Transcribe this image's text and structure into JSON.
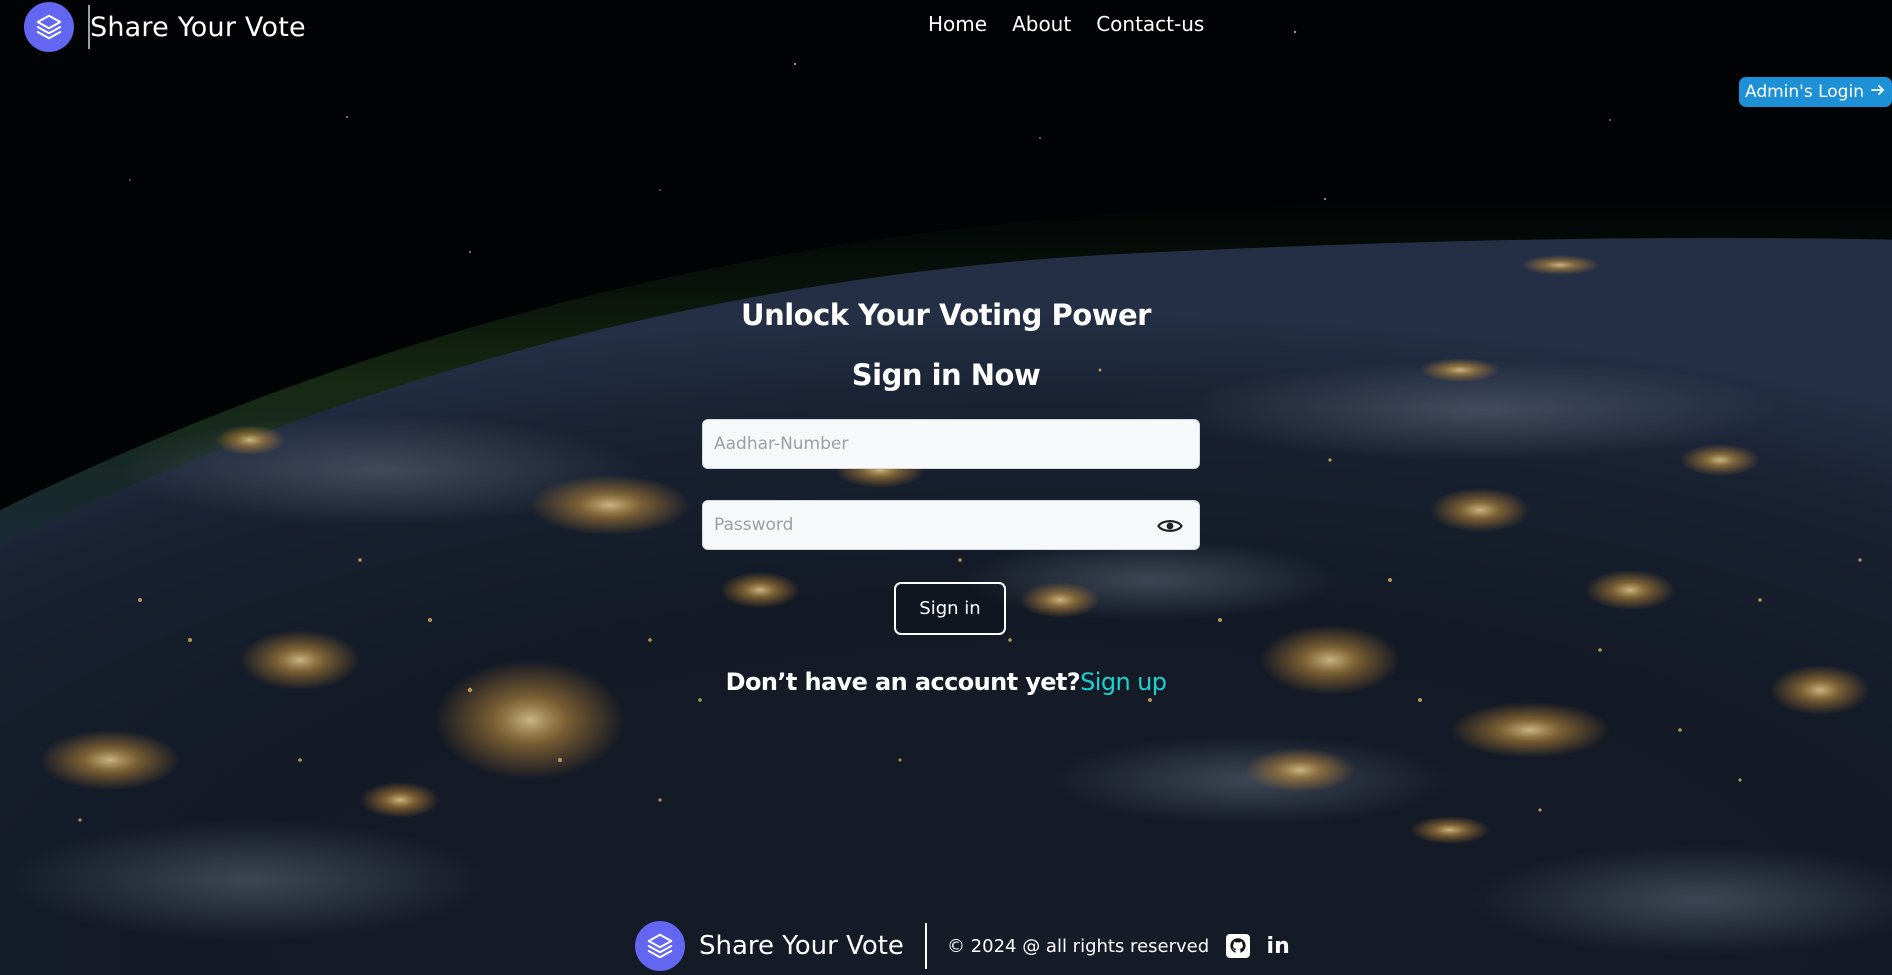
{
  "brand": {
    "name": "Share Your Vote",
    "logo_icon": "layers-icon",
    "logo_color": "#6366f1"
  },
  "nav": {
    "items": [
      "Home",
      "About",
      "Contact-us"
    ]
  },
  "admin": {
    "label": "Admin's Login",
    "icon": "arrow-right-icon",
    "color": "#1e90d6"
  },
  "signin": {
    "heading": "Unlock Your Voting Power",
    "subheading": "Sign in Now",
    "aadhar_placeholder": "Aadhar-Number",
    "password_placeholder": "Password",
    "password_toggle_icon": "eye-icon",
    "button_label": "Sign in",
    "no_account_text": "Don’t have an account yet?",
    "signup_link": "Sign up",
    "signup_link_color": "#19d3d3"
  },
  "footer": {
    "name": "Share Your Vote",
    "copyright": "© 2024 @ all rights reserved",
    "social_icons": [
      "github-icon",
      "linkedin-icon"
    ],
    "linkedin_text": "in"
  }
}
